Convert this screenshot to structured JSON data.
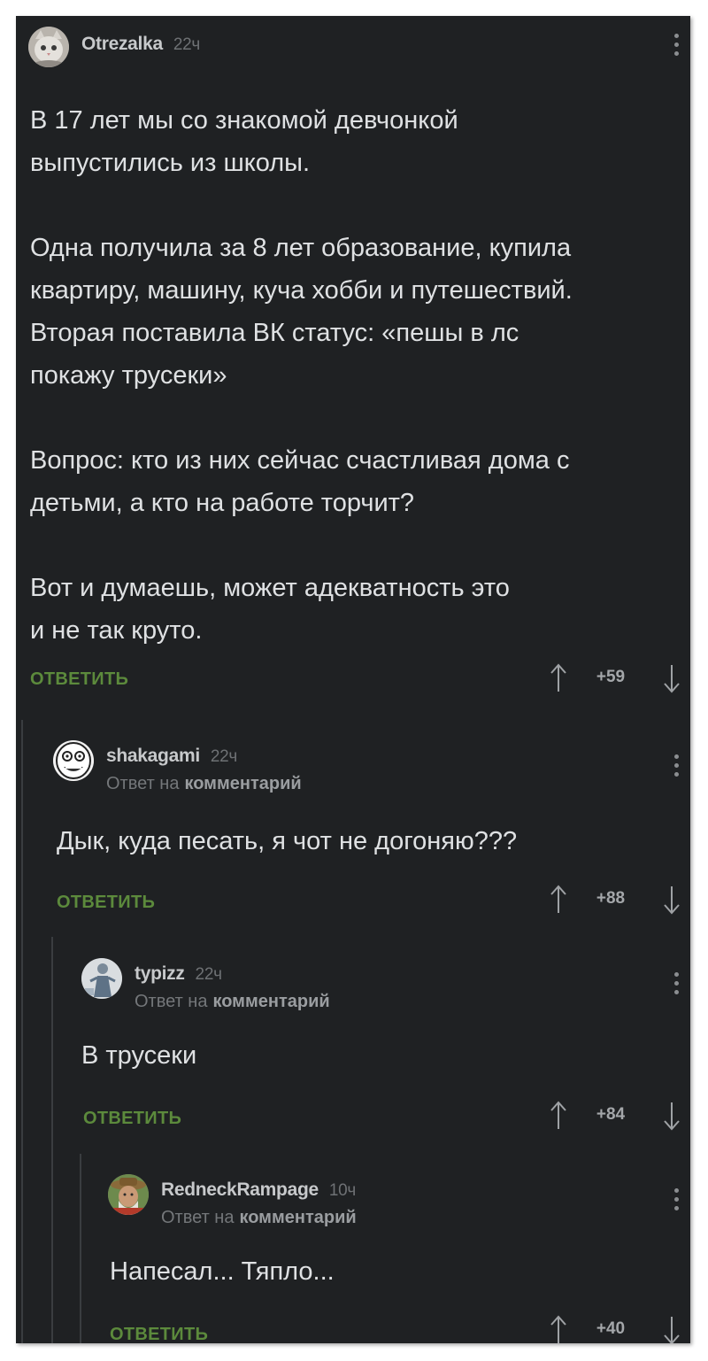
{
  "comments": [
    {
      "username": "Otrezalka",
      "time": "22ч",
      "reply_to_prefix": "",
      "reply_to_link": "",
      "text": "В 17 лет мы со знакомой девчонкой\nвыпустились из школы.\n\nОдна получила за 8 лет образование, купила\nквартиру, машину, куча хобби и путешествий.\nВторая поставила ВК статус: «пешы в лс\nпокажу трусеки»\n\nВопрос: кто из них сейчас счастливая дома с\nдетьми, а кто на работе торчит?\n\nВот и думаешь, может адекватность это\nи не так круто.",
      "reply_label": "ОТВЕТИТЬ",
      "score": "+59",
      "avatar_icon": "cat-avatar"
    },
    {
      "username": "shakagami",
      "time": "22ч",
      "reply_to_prefix": "Ответ на",
      "reply_to_link": "комментарий",
      "text": "Дык, куда песать, я чот не догоняю???",
      "reply_label": "ОТВЕТИТЬ",
      "score": "+88",
      "avatar_icon": "rage-face-avatar"
    },
    {
      "username": "typizz",
      "time": "22ч",
      "reply_to_prefix": "Ответ на",
      "reply_to_link": "комментарий",
      "text": "В трусеки",
      "reply_label": "ОТВЕТИТЬ",
      "score": "+84",
      "avatar_icon": "figure-avatar"
    },
    {
      "username": "RedneckRampage",
      "time": "10ч",
      "reply_to_prefix": "Ответ на",
      "reply_to_link": "комментарий",
      "text": "Напесал... Тяпло...",
      "reply_label": "ОТВЕТИТЬ",
      "score": "+40",
      "avatar_icon": "redneck-avatar"
    }
  ],
  "colors": {
    "background": "#1f2123",
    "text": "#dfe1e3",
    "reply_button": "#5c8a3c",
    "thread_line": "#3a3d40"
  }
}
